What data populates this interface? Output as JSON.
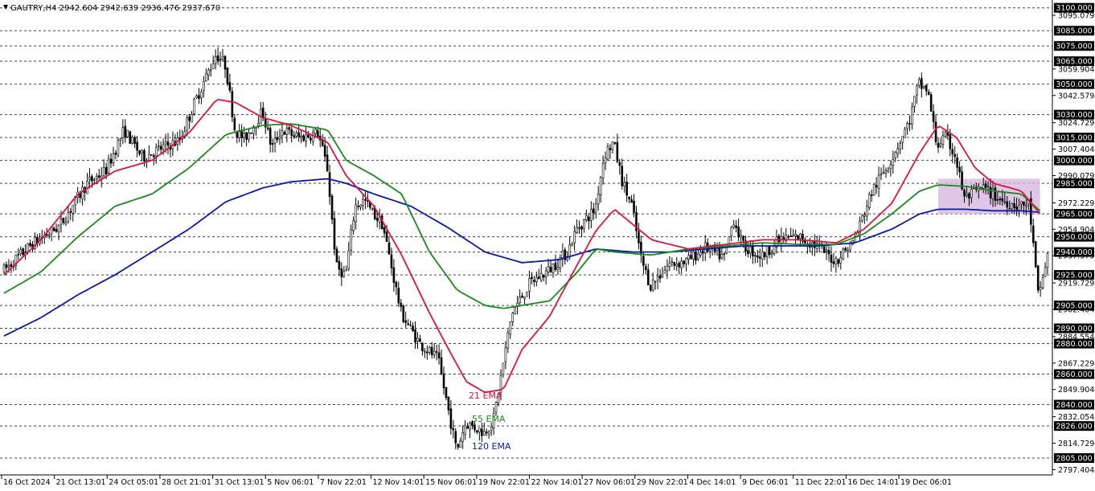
{
  "chart_data": {
    "type": "candlestick",
    "title": "GAUTRY,H4  2942.604 2942.639 2936.476 2937.670",
    "symbol": "GAUTRY",
    "timeframe": "H4",
    "ohlc": {
      "open": 2942.604,
      "high": 2942.639,
      "low": 2936.476,
      "close": 2937.67
    },
    "ylim": [
      2795,
      3103
    ],
    "price_ticks": [
      "3095.079",
      "3059.904",
      "3042.579",
      "3024.729",
      "3007.404",
      "2990.079",
      "2972.229",
      "2954.904",
      "2937.579",
      "2919.729",
      "2902.404",
      "2884.554",
      "2867.229",
      "2849.904",
      "2832.054",
      "2814.729",
      "2797.404"
    ],
    "levels": [
      "3100.000",
      "3085.000",
      "3075.000",
      "3065.000",
      "3050.000",
      "3030.000",
      "3015.000",
      "3000.000",
      "2985.000",
      "2965.000",
      "2950.000",
      "2940.000",
      "2925.000",
      "2905.000",
      "2890.000",
      "2880.000",
      "2860.000",
      "2840.000",
      "2826.000",
      "2805.000"
    ],
    "time_labels": [
      "16 Oct 2024",
      "21 Oct 13:01",
      "24 Oct 05:01",
      "28 Oct 21:01",
      "31 Oct 13:01",
      "5 Nov 06:01",
      "7 Nov 22:01",
      "12 Nov 14:01",
      "15 Nov 06:01",
      "19 Nov 22:01",
      "22 Nov 14:01",
      "27 Nov 06:01",
      "29 Nov 22:01",
      "4 Dec 14:01",
      "9 Dec 06:01",
      "11 Dec 22:01",
      "16 Dec 14:01",
      "19 Dec 06:01"
    ],
    "price_path": [
      [
        0,
        2928
      ],
      [
        3,
        2945
      ],
      [
        6,
        2957
      ],
      [
        9,
        2985
      ],
      [
        11,
        2993
      ],
      [
        13,
        3020
      ],
      [
        15,
        3002
      ],
      [
        17,
        3008
      ],
      [
        19,
        3013
      ],
      [
        21,
        3043
      ],
      [
        23,
        3070
      ],
      [
        24,
        3062
      ],
      [
        25,
        3020
      ],
      [
        26,
        3014
      ],
      [
        28,
        3032
      ],
      [
        29,
        3008
      ],
      [
        30,
        3020
      ],
      [
        32,
        3015
      ],
      [
        34,
        3018
      ],
      [
        35,
        2995
      ],
      [
        36,
        2930
      ],
      [
        37,
        2925
      ],
      [
        38,
        2970
      ],
      [
        39,
        2974
      ],
      [
        40,
        2965
      ],
      [
        41,
        2958
      ],
      [
        43,
        2900
      ],
      [
        45,
        2880
      ],
      [
        47,
        2870
      ],
      [
        48,
        2840
      ],
      [
        49,
        2810
      ],
      [
        50,
        2828
      ],
      [
        52,
        2822
      ],
      [
        53,
        2830
      ],
      [
        55,
        2900
      ],
      [
        57,
        2920
      ],
      [
        59,
        2928
      ],
      [
        61,
        2940
      ],
      [
        62,
        2955
      ],
      [
        64,
        2968
      ],
      [
        65,
        3004
      ],
      [
        66,
        3012
      ],
      [
        67,
        2985
      ],
      [
        68,
        2970
      ],
      [
        69,
        2935
      ],
      [
        70,
        2918
      ],
      [
        72,
        2932
      ],
      [
        74,
        2934
      ],
      [
        76,
        2943
      ],
      [
        78,
        2936
      ],
      [
        79,
        2962
      ],
      [
        80,
        2944
      ],
      [
        82,
        2937
      ],
      [
        84,
        2948
      ],
      [
        86,
        2950
      ],
      [
        88,
        2944
      ],
      [
        90,
        2934
      ],
      [
        92,
        2947
      ],
      [
        94,
        2980
      ],
      [
        96,
        3000
      ],
      [
        98,
        3025
      ],
      [
        99,
        3050
      ],
      [
        100,
        3046
      ],
      [
        101,
        3010
      ],
      [
        102,
        3015
      ],
      [
        103,
        3003
      ],
      [
        104,
        2975
      ],
      [
        106,
        2982
      ],
      [
        108,
        2974
      ],
      [
        110,
        2970
      ],
      [
        111,
        2972
      ],
      [
        112,
        2910
      ],
      [
        113,
        2938
      ]
    ],
    "series": [
      {
        "name": "21 EMA",
        "color": "#dc143c",
        "points": [
          [
            0,
            2925
          ],
          [
            4,
            2948
          ],
          [
            8,
            2978
          ],
          [
            12,
            2993
          ],
          [
            16,
            3000
          ],
          [
            20,
            3018
          ],
          [
            23,
            3040
          ],
          [
            25,
            3038
          ],
          [
            28,
            3028
          ],
          [
            31,
            3023
          ],
          [
            35,
            3012
          ],
          [
            37,
            2990
          ],
          [
            40,
            2970
          ],
          [
            43,
            2938
          ],
          [
            46,
            2900
          ],
          [
            48,
            2877
          ],
          [
            50,
            2855
          ],
          [
            52,
            2848
          ],
          [
            54,
            2850
          ],
          [
            56,
            2876
          ],
          [
            59,
            2898
          ],
          [
            62,
            2932
          ],
          [
            64,
            2954
          ],
          [
            66,
            2968
          ],
          [
            68,
            2958
          ],
          [
            70,
            2948
          ],
          [
            74,
            2942
          ],
          [
            78,
            2945
          ],
          [
            82,
            2948
          ],
          [
            86,
            2948
          ],
          [
            90,
            2946
          ],
          [
            93,
            2955
          ],
          [
            96,
            2972
          ],
          [
            99,
            3005
          ],
          [
            101,
            3023
          ],
          [
            103,
            3015
          ],
          [
            105,
            2995
          ],
          [
            107,
            2985
          ],
          [
            110,
            2980
          ],
          [
            112,
            2965
          ]
        ]
      },
      {
        "name": "55 EMA",
        "color": "#1a8a1a",
        "points": [
          [
            0,
            2913
          ],
          [
            4,
            2927
          ],
          [
            8,
            2950
          ],
          [
            12,
            2970
          ],
          [
            16,
            2978
          ],
          [
            20,
            2995
          ],
          [
            24,
            3017
          ],
          [
            28,
            3023
          ],
          [
            31,
            3024
          ],
          [
            35,
            3020
          ],
          [
            37,
            3000
          ],
          [
            40,
            2990
          ],
          [
            43,
            2978
          ],
          [
            46,
            2940
          ],
          [
            49,
            2915
          ],
          [
            52,
            2905
          ],
          [
            54,
            2903
          ],
          [
            56,
            2905
          ],
          [
            59,
            2908
          ],
          [
            62,
            2927
          ],
          [
            64,
            2942
          ],
          [
            66,
            2940
          ],
          [
            70,
            2938
          ],
          [
            74,
            2942
          ],
          [
            78,
            2944
          ],
          [
            82,
            2946
          ],
          [
            86,
            2945
          ],
          [
            90,
            2945
          ],
          [
            93,
            2952
          ],
          [
            96,
            2965
          ],
          [
            99,
            2980
          ],
          [
            101,
            2984
          ],
          [
            104,
            2983
          ],
          [
            107,
            2980
          ],
          [
            110,
            2978
          ],
          [
            112,
            2967
          ]
        ]
      },
      {
        "name": "120 EMA",
        "color": "#0a1aa8",
        "points": [
          [
            0,
            2885
          ],
          [
            4,
            2897
          ],
          [
            8,
            2912
          ],
          [
            12,
            2925
          ],
          [
            16,
            2940
          ],
          [
            20,
            2955
          ],
          [
            24,
            2973
          ],
          [
            28,
            2982
          ],
          [
            31,
            2986
          ],
          [
            35,
            2988
          ],
          [
            37,
            2985
          ],
          [
            40,
            2978
          ],
          [
            44,
            2970
          ],
          [
            48,
            2956
          ],
          [
            52,
            2940
          ],
          [
            56,
            2933
          ],
          [
            60,
            2935
          ],
          [
            64,
            2942
          ],
          [
            68,
            2940
          ],
          [
            72,
            2940
          ],
          [
            76,
            2942
          ],
          [
            80,
            2944
          ],
          [
            84,
            2944
          ],
          [
            88,
            2944
          ],
          [
            92,
            2946
          ],
          [
            96,
            2955
          ],
          [
            99,
            2965
          ],
          [
            101,
            2968
          ],
          [
            104,
            2968
          ],
          [
            107,
            2967
          ],
          [
            110,
            2967
          ],
          [
            112,
            2966
          ]
        ]
      }
    ],
    "highlight": {
      "x": [
        101,
        112
      ],
      "y": [
        2965,
        2988
      ],
      "color": "#d8b8e0"
    },
    "grid": true
  }
}
